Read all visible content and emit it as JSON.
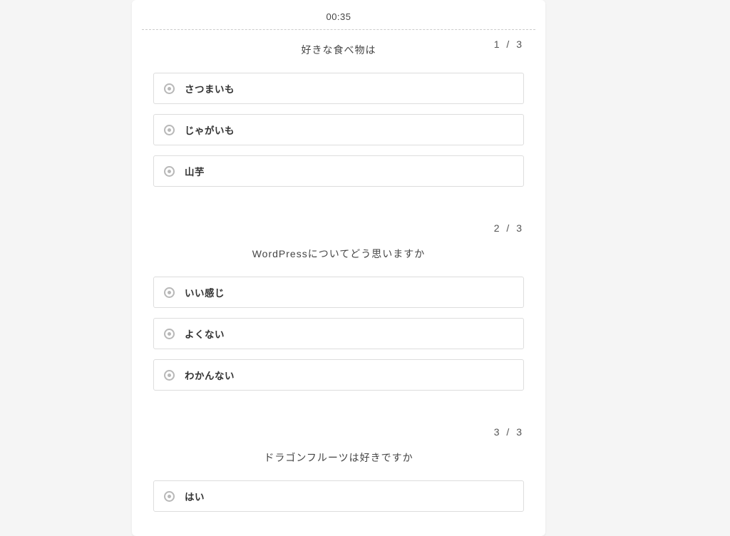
{
  "timer": "00:35",
  "questions": [
    {
      "counter": "1 / 3",
      "text": "好きな食べ物は",
      "options": [
        "さつまいも",
        "じゃがいも",
        "山芋"
      ]
    },
    {
      "counter": "2 / 3",
      "text": "WordPressについてどう思いますか",
      "options": [
        "いい感じ",
        "よくない",
        "わかんない"
      ]
    },
    {
      "counter": "3 / 3",
      "text": "ドラゴンフルーツは好きですか",
      "options": [
        "はい"
      ]
    }
  ]
}
